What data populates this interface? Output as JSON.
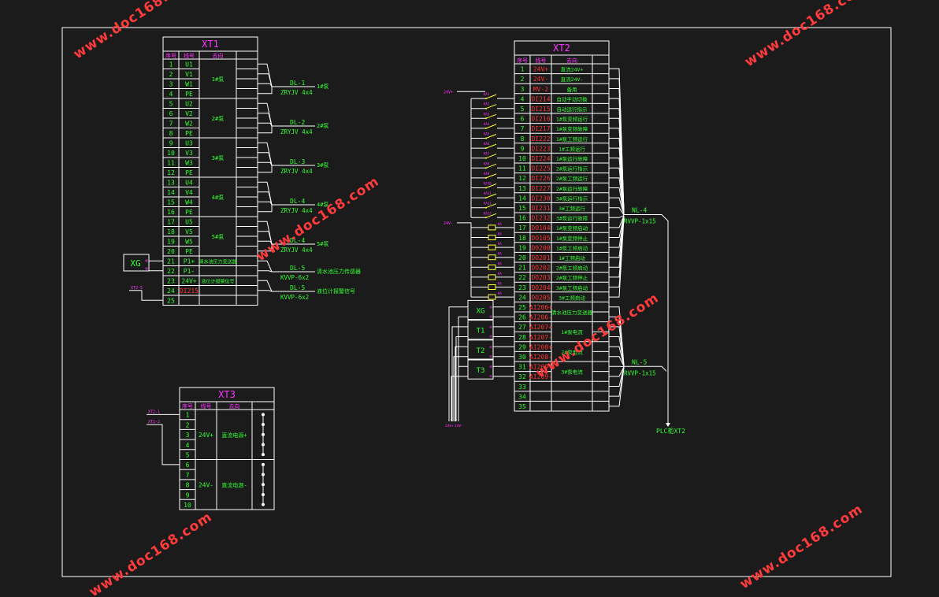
{
  "colors": {
    "background": "#1b1b1b",
    "line": "#ffffff",
    "green": "#33ff33",
    "magenta": "#ff33ff",
    "red": "#ff3333",
    "yellow": "#ffff33",
    "watermark": "#ff3b3b"
  },
  "watermark": "www.doc168.com",
  "xt1": {
    "title": "XT1",
    "headers": [
      "序号",
      "线号",
      "去向"
    ],
    "rows": [
      {
        "n": "1",
        "w": "U1"
      },
      {
        "n": "2",
        "w": "V1"
      },
      {
        "n": "3",
        "w": "W1"
      },
      {
        "n": "4",
        "w": "PE"
      },
      {
        "n": "5",
        "w": "U2"
      },
      {
        "n": "6",
        "w": "V2"
      },
      {
        "n": "7",
        "w": "W2"
      },
      {
        "n": "8",
        "w": "PE"
      },
      {
        "n": "9",
        "w": "U3"
      },
      {
        "n": "10",
        "w": "V3"
      },
      {
        "n": "11",
        "w": "W3"
      },
      {
        "n": "12",
        "w": "PE"
      },
      {
        "n": "13",
        "w": "U4"
      },
      {
        "n": "14",
        "w": "V4"
      },
      {
        "n": "15",
        "w": "W4"
      },
      {
        "n": "16",
        "w": "PE"
      },
      {
        "n": "17",
        "w": "U5"
      },
      {
        "n": "18",
        "w": "V5"
      },
      {
        "n": "19",
        "w": "W5"
      },
      {
        "n": "20",
        "w": "PE"
      },
      {
        "n": "21",
        "w": "P1+"
      },
      {
        "n": "22",
        "w": "P1-"
      },
      {
        "n": "23",
        "w": "24V+"
      },
      {
        "n": "24",
        "w": "DI215",
        "red": true
      },
      {
        "n": "25",
        "w": ""
      }
    ],
    "groups": [
      "1#泵",
      "2#泵",
      "3#泵",
      "4#泵",
      "5#泵",
      "清水池压力变送器",
      "液位计报警信号"
    ],
    "cables": [
      {
        "id": "DL-1",
        "spec": "ZRYJV 4x4",
        "dest": "1#泵"
      },
      {
        "id": "DL-2",
        "spec": "ZRYJV 4x4",
        "dest": "2#泵"
      },
      {
        "id": "DL-3",
        "spec": "ZRYJV 4x4",
        "dest": "3#泵"
      },
      {
        "id": "DL-4",
        "spec": "ZRYJV 4x4",
        "dest": "4#泵"
      },
      {
        "id": "DL-4",
        "spec": "ZRYJV 4x4",
        "dest": "5#泵"
      },
      {
        "id": "DL-5",
        "spec": "KVVP-6x2",
        "dest": "清水池压力传感器"
      },
      {
        "id": "DL-5",
        "spec": "KVVP-6x2",
        "dest": "液位计报警信号"
      }
    ],
    "xg_label": "XG",
    "side_label": "XT2-5"
  },
  "xt2": {
    "title": "XT2",
    "headers": [
      "序号",
      "线号",
      "去向"
    ],
    "rows": [
      {
        "n": "1",
        "w": "24V+",
        "d": "直流24V+"
      },
      {
        "n": "2",
        "w": "24V-",
        "d": "直流24V-"
      },
      {
        "n": "3",
        "w": "MV-2",
        "d": "备用"
      },
      {
        "n": "4",
        "w": "DI214",
        "d": "自动手动切换"
      },
      {
        "n": "5",
        "w": "DI215",
        "d": "自动运行指示"
      },
      {
        "n": "6",
        "w": "DI216",
        "d": "1#泵变频运行"
      },
      {
        "n": "7",
        "w": "DI217",
        "d": "1#泵变频故障"
      },
      {
        "n": "8",
        "w": "DI222",
        "d": "1#泵工频运行"
      },
      {
        "n": "9",
        "w": "DI223",
        "d": "1#工频运行"
      },
      {
        "n": "10",
        "w": "DI224",
        "d": "1#泵运行故障"
      },
      {
        "n": "11",
        "w": "DI225",
        "d": "2#泵运行指示"
      },
      {
        "n": "12",
        "w": "DI226",
        "d": "2#泵工频运行"
      },
      {
        "n": "13",
        "w": "DI227",
        "d": "2#泵运行故障"
      },
      {
        "n": "14",
        "w": "DI230",
        "d": "3#泵运行指示"
      },
      {
        "n": "15",
        "w": "DI231",
        "d": "3#工频运行"
      },
      {
        "n": "16",
        "w": "DI232",
        "d": "3#泵运行故障"
      },
      {
        "n": "17",
        "w": "DO104",
        "d": "1#泵变频启动"
      },
      {
        "n": "18",
        "w": "DO105",
        "d": "1#泵变频停止"
      },
      {
        "n": "19",
        "w": "DO200",
        "d": "1#泵工频启动"
      },
      {
        "n": "20",
        "w": "DO201",
        "d": "1#工频启动"
      },
      {
        "n": "21",
        "w": "DO202",
        "d": "2#泵工频启动"
      },
      {
        "n": "22",
        "w": "DO203",
        "d": "2#泵工频停止"
      },
      {
        "n": "23",
        "w": "DO204",
        "d": "3#泵工频启动"
      },
      {
        "n": "24",
        "w": "DO205",
        "d": "3#工频启动"
      },
      {
        "n": "25",
        "w": "AI206+",
        "d": "清水池压力变送器"
      },
      {
        "n": "26",
        "w": "AI206-",
        "d": ""
      },
      {
        "n": "27",
        "w": "AI207+",
        "d": "1#泵电流"
      },
      {
        "n": "28",
        "w": "AI207-",
        "d": ""
      },
      {
        "n": "29",
        "w": "AI208+",
        "d": "2#泵电流"
      },
      {
        "n": "30",
        "w": "AI208-",
        "d": ""
      },
      {
        "n": "31",
        "w": "AI209+",
        "d": "3#泵电流"
      },
      {
        "n": "32",
        "w": "AI209-",
        "d": ""
      },
      {
        "n": "33",
        "w": "",
        "d": ""
      },
      {
        "n": "34",
        "w": "",
        "d": ""
      },
      {
        "n": "35",
        "w": "",
        "d": ""
      }
    ],
    "input_label": "24V+",
    "output_label": "24V-",
    "devices": [
      "XG",
      "T1",
      "T2",
      "T3"
    ],
    "bottom_labels": [
      "24V+",
      "24V-"
    ],
    "cables": [
      {
        "id": "NL-4",
        "spec": "RVVP-1x15"
      },
      {
        "id": "NL-5",
        "spec": "RVVP-1x15"
      }
    ],
    "plc_label": "PLC柜XT2"
  },
  "xt3": {
    "title": "XT3",
    "headers": [
      "序号",
      "线号",
      "去向"
    ],
    "rows": [
      "1",
      "2",
      "3",
      "4",
      "5",
      "6",
      "7",
      "8",
      "9",
      "10"
    ],
    "groups": [
      {
        "wire": "24V+",
        "dest": "直流电源+"
      },
      {
        "wire": "24V-",
        "dest": "直流电源-"
      }
    ],
    "refs": [
      "XT2-1",
      "XT2-2"
    ]
  }
}
